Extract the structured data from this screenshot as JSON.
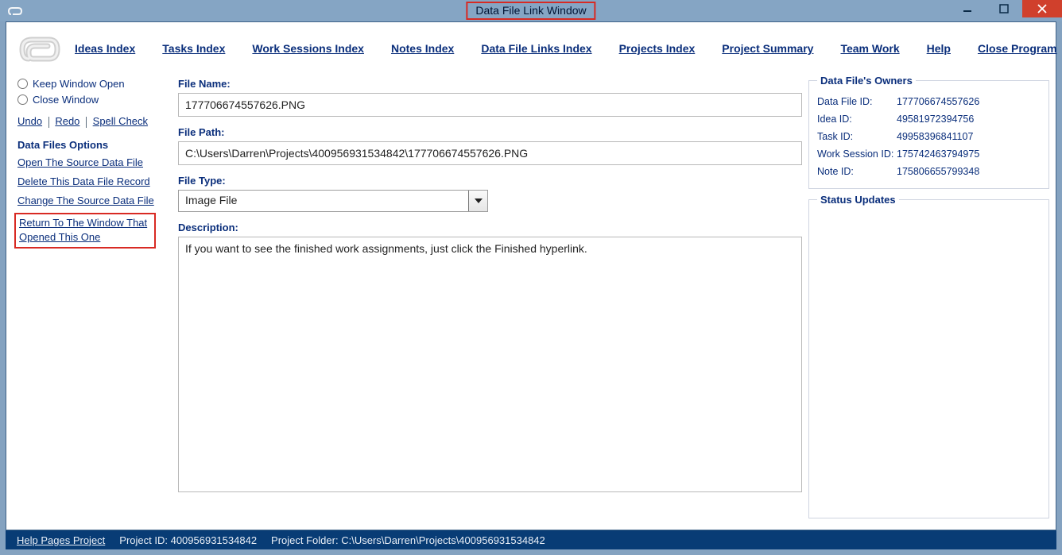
{
  "window": {
    "title": "Data File Link Window"
  },
  "menu": {
    "ideas": "Ideas Index",
    "tasks": "Tasks Index",
    "work": "Work Sessions Index",
    "notes": "Notes Index",
    "datafile": "Data File Links Index",
    "projects": "Projects Index",
    "summary": "Project Summary",
    "team": "Team Work",
    "help": "Help",
    "close": "Close Program"
  },
  "left": {
    "keep_open": "Keep Window Open",
    "close_win": "Close Window",
    "undo": "Undo",
    "redo": "Redo",
    "spell": "Spell Check",
    "section": "Data Files Options",
    "open_source": "Open The Source Data File",
    "delete_record": "Delete This Data File Record",
    "change_source": "Change The Source Data File",
    "return_line1": "Return To The Window That",
    "return_line2": "Opened This One"
  },
  "fields": {
    "file_name_label": "File Name:",
    "file_name_value": "177706674557626.PNG",
    "file_path_label": "File Path:",
    "file_path_value": "C:\\Users\\Darren\\Projects\\400956931534842\\177706674557626.PNG",
    "file_type_label": "File Type:",
    "file_type_value": "Image File",
    "description_label": "Description:",
    "description_value": "If you want to see the finished work assignments, just click the Finished hyperlink."
  },
  "owners": {
    "legend": "Data File's Owners",
    "data_file_id_k": "Data File ID:",
    "data_file_id_v": "177706674557626",
    "idea_id_k": "Idea ID:",
    "idea_id_v": "49581972394756",
    "task_id_k": "Task ID:",
    "task_id_v": "49958396841107",
    "work_id_k": "Work Session ID:",
    "work_id_v": "175742463794975",
    "note_id_k": "Note ID:",
    "note_id_v": "175806655799348"
  },
  "status_legend": "Status Updates",
  "statusbar": {
    "help_pages": "Help Pages Project",
    "project_id_label": "Project ID:",
    "project_id": "400956931534842",
    "project_folder_label": "Project Folder:",
    "project_folder": "C:\\Users\\Darren\\Projects\\400956931534842"
  }
}
